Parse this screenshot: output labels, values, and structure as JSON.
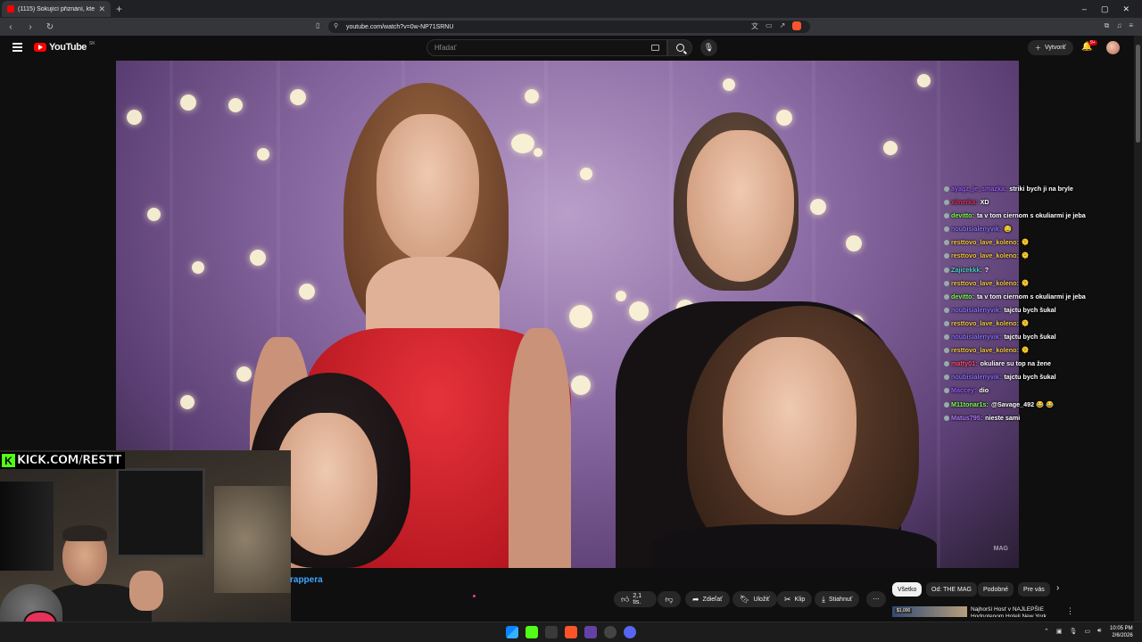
{
  "browser": {
    "tab_title": "(1115) Šokující přiznání, které",
    "new_tab": "+",
    "url": "youtube.com/watch?v=0w-NP71SRNU",
    "window_controls": [
      "–",
      "▢",
      "✕"
    ]
  },
  "youtube": {
    "logo_text": "YouTube",
    "region": "SK",
    "search_placeholder": "Hľadať",
    "create_label": "Vytvoriť",
    "notification_count": "9+"
  },
  "stream_overlay": {
    "kick_label": "KICK.COM/RESTT"
  },
  "video": {
    "watermark": "MAG",
    "title_fragment": "rappera"
  },
  "chat": [
    {
      "user": "ayagz_je_smazka:",
      "user_color": "#9b59ff",
      "msg": "striki bych ji na bryle"
    },
    {
      "user": "ximerka:",
      "user_color": "#e03050",
      "msg": "XD"
    },
    {
      "user": "devitto:",
      "user_color": "#7cff4a",
      "msg": "ta v tom ciernom s okuliarmi je jeba"
    },
    {
      "user": "noubisialenyvik:",
      "user_color": "#8a6cff",
      "msg": "🤤"
    },
    {
      "user": "resttovo_lave_koleno:",
      "user_color": "#f5c842",
      "msg": "🫠"
    },
    {
      "user": "resttovo_lave_koleno:",
      "user_color": "#f5c842",
      "msg": "🫠"
    },
    {
      "user": "Zajicekkk:",
      "user_color": "#4fd1c5",
      "msg": "?"
    },
    {
      "user": "resttovo_lave_koleno:",
      "user_color": "#f5c842",
      "msg": "🫠"
    },
    {
      "user": "devitto:",
      "user_color": "#7cff4a",
      "msg": "ta v tom ciernom s okuliarmi je jeba"
    },
    {
      "user": "noubisialenyvik:",
      "user_color": "#8a6cff",
      "msg": "tajctu bych šukal"
    },
    {
      "user": "resttovo_lave_koleno:",
      "user_color": "#f5c842",
      "msg": "🫠"
    },
    {
      "user": "noubisialenyvik:",
      "user_color": "#8a6cff",
      "msg": "tajctu bych šukal"
    },
    {
      "user": "resttovo_lave_koleno:",
      "user_color": "#f5c842",
      "msg": "🫠"
    },
    {
      "user": "matty01:",
      "user_color": "#ff4d6d",
      "msg": "okuliare su top na žene"
    },
    {
      "user": "noubisialenyvik:",
      "user_color": "#8a6cff",
      "msg": "tajctu bych šukal"
    },
    {
      "user": "Maccey:",
      "user_color": "#9b59ff",
      "msg": "dio"
    },
    {
      "user": "M11tonar1s:",
      "user_color": "#7cff4a",
      "msg": "@Savage_492 😂 😂"
    },
    {
      "user": "Matus795:",
      "user_color": "#b07cff",
      "msg": "nieste sami"
    }
  ],
  "actions": {
    "like_count": "2,1 tis.",
    "share": "Zdieľať",
    "save": "Uložiť",
    "clip": "Klip",
    "download": "Stiahnuť",
    "more": "⋯"
  },
  "chips": [
    "Všetko",
    "Od: THE MAG",
    "Podobné",
    "Pre vás"
  ],
  "recommendation": {
    "price": "$1,000",
    "title": "Najhorší Hosť v NAJLEPŠIE Hodnotenom Hoteli New York"
  },
  "taskbar": {
    "time": "10:05 PM",
    "date": "2/6/2026"
  },
  "colors": {
    "accent_red": "#ff0000",
    "kick_green": "#53fc18",
    "link_blue": "#3ea6ff"
  }
}
